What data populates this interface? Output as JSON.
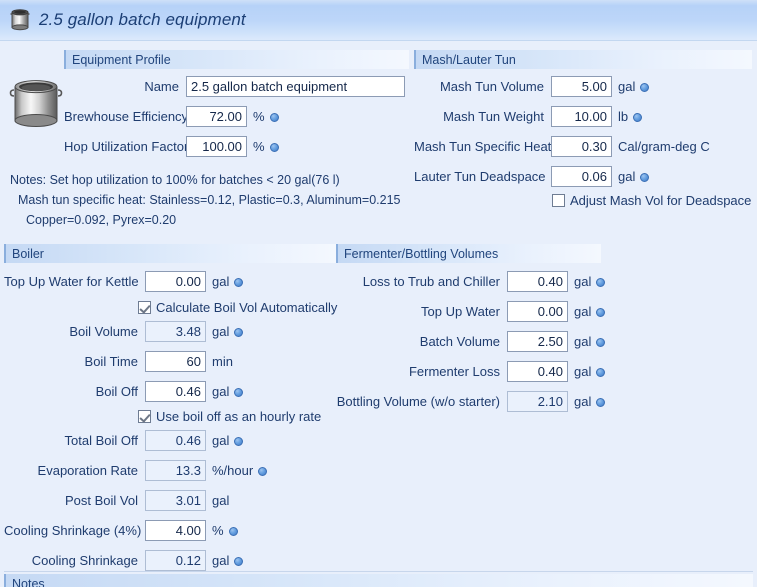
{
  "window": {
    "title": "2.5 gallon batch equipment",
    "icon": "kettle-icon"
  },
  "colors": {
    "accent": "#3d78c6",
    "title_text": "#1c3f75",
    "label_text": "#1f3c6e",
    "surface": "#e8effb",
    "field_bg": "#ffffff",
    "readonly_bg": "#eaf1fc"
  },
  "equipment_profile": {
    "heading": "Equipment Profile",
    "icon": "kettle-icon",
    "fields": [
      {
        "label": "Name",
        "value": "2.5 gallon batch equipment",
        "unit": "",
        "dot": false,
        "readonly": false
      },
      {
        "label": "Brewhouse Efficiency",
        "value": "72.00",
        "unit": "%",
        "dot": true,
        "readonly": false
      },
      {
        "label": "Hop Utilization Factor",
        "value": "100.00",
        "unit": "%",
        "dot": true,
        "readonly": false
      }
    ],
    "notes": [
      "Notes: Set hop utilization to 100% for batches < 20 gal(76 l)",
      "Mash tun specific heat: Stainless=0.12, Plastic=0.3, Aluminum=0.215",
      "Copper=0.092, Pyrex=0.20"
    ]
  },
  "mash_lauter_tun": {
    "heading": "Mash/Lauter Tun",
    "fields": [
      {
        "label": "Mash Tun Volume",
        "value": "5.00",
        "unit": "gal",
        "dot": true,
        "readonly": false
      },
      {
        "label": "Mash Tun Weight",
        "value": "10.00",
        "unit": "lb",
        "dot": true,
        "readonly": false
      },
      {
        "label": "Mash Tun Specific Heat",
        "value": "0.30",
        "unit": "Cal/gram-deg C",
        "dot": false,
        "readonly": false
      },
      {
        "label": "Lauter Tun Deadspace",
        "value": "0.06",
        "unit": "gal",
        "dot": true,
        "readonly": false
      }
    ],
    "checkbox": {
      "label": "Adjust Mash Vol for Deadspace",
      "checked": false
    }
  },
  "boiler": {
    "heading": "Boiler",
    "fields": [
      {
        "label": "Top Up Water for Kettle",
        "value": "0.00",
        "unit": "gal",
        "dot": true,
        "readonly": false
      },
      {
        "label": "Boil Volume",
        "value": "3.48",
        "unit": "gal",
        "dot": true,
        "readonly": true
      },
      {
        "label": "Boil Time",
        "value": "60",
        "unit": "min",
        "dot": false,
        "readonly": false
      },
      {
        "label": "Boil Off",
        "value": "0.46",
        "unit": "gal",
        "dot": true,
        "readonly": false
      },
      {
        "label": "Total Boil Off",
        "value": "0.46",
        "unit": "gal",
        "dot": true,
        "readonly": true
      },
      {
        "label": "Evaporation Rate",
        "value": "13.3",
        "unit": "%/hour",
        "dot": true,
        "readonly": true
      },
      {
        "label": "Post Boil Vol",
        "value": "3.01",
        "unit": "gal",
        "dot": false,
        "readonly": true
      },
      {
        "label": "Cooling Shrinkage (4%)",
        "value": "4.00",
        "unit": "%",
        "dot": true,
        "readonly": false
      },
      {
        "label": "Cooling Shrinkage",
        "value": "0.12",
        "unit": "gal",
        "dot": true,
        "readonly": true
      }
    ],
    "checkbox_calc_boil_vol": {
      "label": "Calculate Boil Vol Automatically",
      "checked": true
    },
    "checkbox_hourly_rate": {
      "label": "Use boil off as an hourly rate",
      "checked": true
    }
  },
  "fermenter_bottling": {
    "heading": "Fermenter/Bottling Volumes",
    "fields": [
      {
        "label": "Loss to Trub and Chiller",
        "value": "0.40",
        "unit": "gal",
        "dot": true,
        "readonly": false
      },
      {
        "label": "Top Up Water",
        "value": "0.00",
        "unit": "gal",
        "dot": true,
        "readonly": false
      },
      {
        "label": "Batch Volume",
        "value": "2.50",
        "unit": "gal",
        "dot": true,
        "readonly": false
      },
      {
        "label": "Fermenter Loss",
        "value": "0.40",
        "unit": "gal",
        "dot": true,
        "readonly": false
      },
      {
        "label": "Bottling Volume (w/o starter)",
        "value": "2.10",
        "unit": "gal",
        "dot": true,
        "readonly": true
      }
    ]
  },
  "notes_section": {
    "heading": "Notes"
  }
}
